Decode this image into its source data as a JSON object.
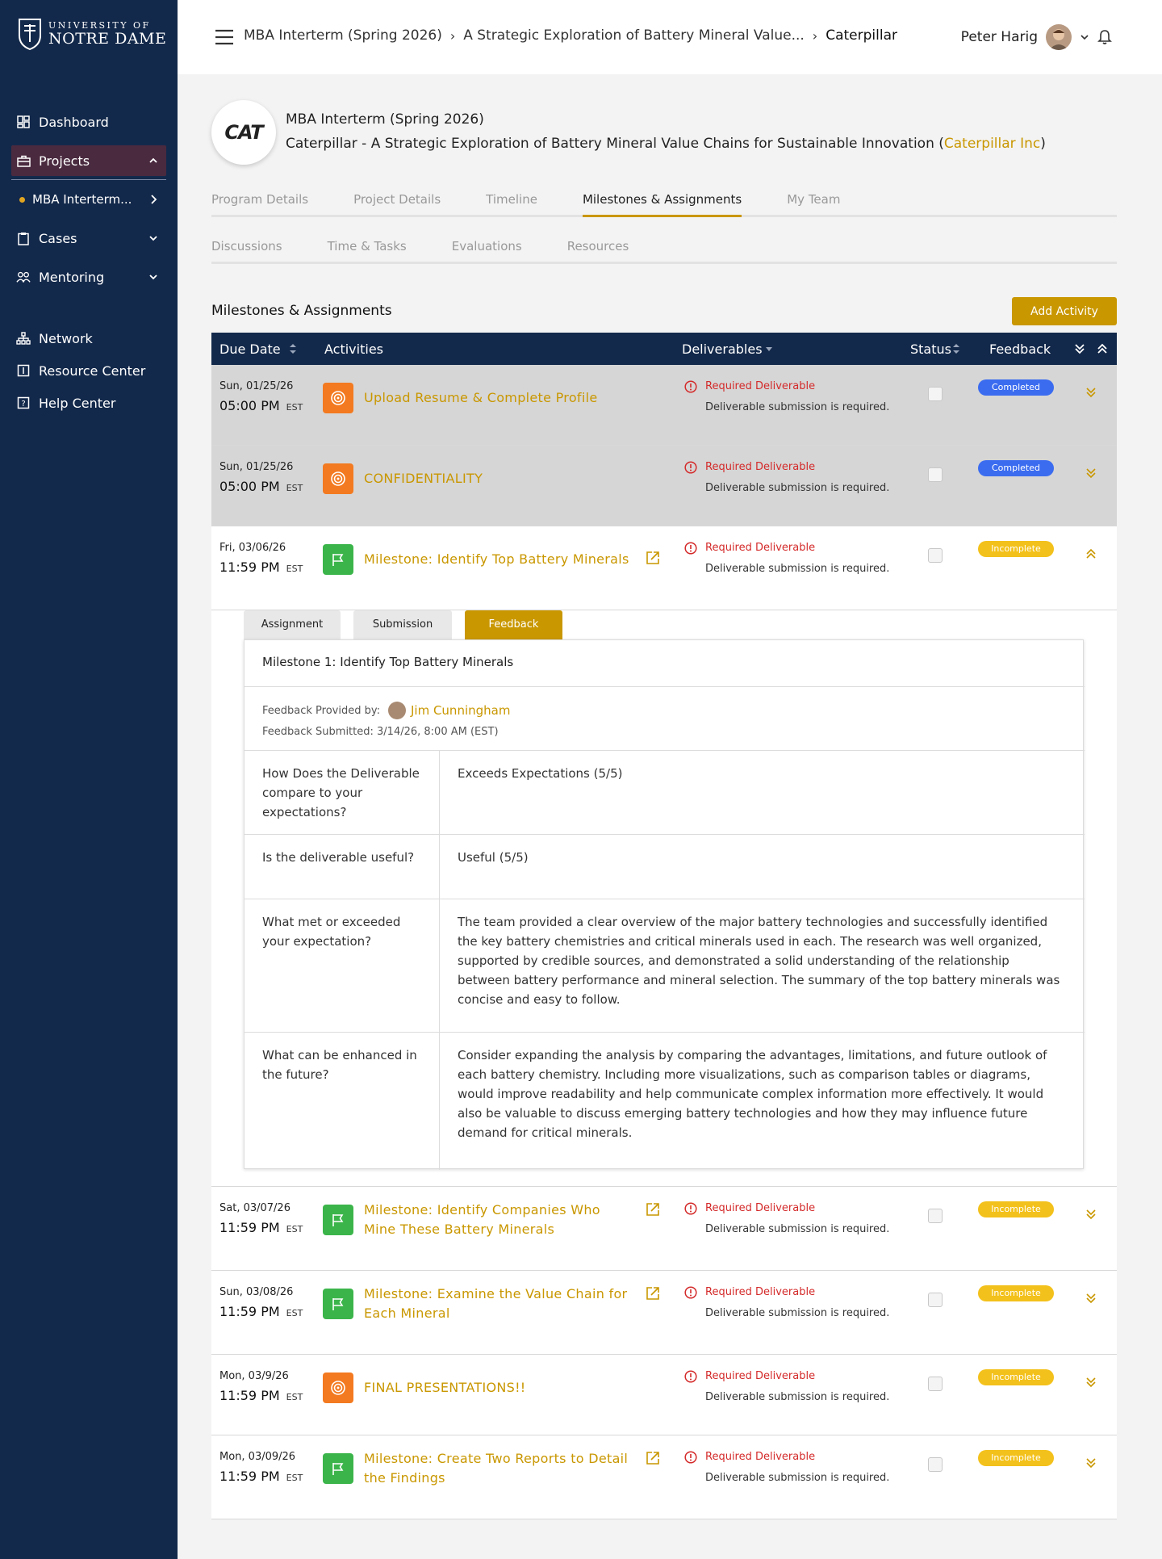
{
  "sidebar": {
    "logo": {
      "line1": "UNIVERSITY OF",
      "line2": "NOTRE DAME"
    },
    "items": [
      {
        "label": "Dashboard",
        "icon": "dashboard-icon"
      },
      {
        "label": "Projects",
        "icon": "briefcase-icon"
      },
      {
        "label": "MBA Interterm...",
        "icon": "dot"
      },
      {
        "label": "Cases",
        "icon": "clipboard-icon"
      },
      {
        "label": "Mentoring",
        "icon": "people-icon"
      },
      {
        "label": "Network",
        "icon": "network-icon"
      },
      {
        "label": "Resource Center",
        "icon": "book-icon"
      },
      {
        "label": "Help Center",
        "icon": "help-icon"
      }
    ]
  },
  "topbar": {
    "crumbs": [
      "MBA Interterm (Spring 2026)",
      "A Strategic Exploration of Battery Mineral Value...",
      "Caterpillar"
    ],
    "user_name": "Peter Harig"
  },
  "header": {
    "logo_text": "CAT",
    "program": "MBA Interterm (Spring 2026)",
    "project_prefix": "Caterpillar - A Strategic Exploration of Battery Mineral Value Chains for Sustainable Innovation (",
    "company": "Caterpillar Inc",
    "project_suffix": ")"
  },
  "tabs1": [
    "Program Details",
    "Project Details",
    "Timeline",
    "Milestones & Assignments",
    "My Team"
  ],
  "tabs2": [
    "Discussions",
    "Time & Tasks",
    "Evaluations",
    "Resources"
  ],
  "section_title": "Milestones & Assignments",
  "add_activity": "Add Activity",
  "table_headers": {
    "due": "Due Date",
    "activities": "Activities",
    "deliverables": "Deliverables",
    "status": "Status",
    "feedback": "Feedback"
  },
  "rows": [
    {
      "date": "Sun, 01/25/26",
      "time": "05:00 PM",
      "tz": "EST",
      "title": "Upload Resume & Complete Profile",
      "icon": "target-icon",
      "req": "Required Deliverable",
      "sub": "Deliverable submission is required.",
      "badge": "Completed"
    },
    {
      "date": "Sun, 01/25/26",
      "time": "05:00 PM",
      "tz": "EST",
      "title": "CONFIDENTIALITY",
      "icon": "target-icon",
      "req": "Required Deliverable",
      "sub": "Deliverable submission is required.",
      "badge": "Completed"
    },
    {
      "date": "Fri, 03/06/26",
      "time": "11:59 PM",
      "tz": "EST",
      "title": "Milestone: Identify Top Battery Minerals",
      "icon": "flag-icon",
      "req": "Required Deliverable",
      "sub": "Deliverable submission is required.",
      "badge": "Incomplete"
    },
    {
      "date": "Sat, 03/07/26",
      "time": "11:59 PM",
      "tz": "EST",
      "title": "Milestone: Identify Companies Who Mine These Battery Minerals",
      "icon": "flag-icon",
      "req": "Required Deliverable",
      "sub": "Deliverable submission is required.",
      "badge": "Incomplete"
    },
    {
      "date": "Sun, 03/08/26",
      "time": "11:59 PM",
      "tz": "EST",
      "title": "Milestone: Examine the Value Chain for Each Mineral",
      "icon": "flag-icon",
      "req": "Required Deliverable",
      "sub": "Deliverable submission is required.",
      "badge": "Incomplete"
    },
    {
      "date": "Mon, 03/9/26",
      "time": "11:59 PM",
      "tz": "EST",
      "title": "FINAL PRESENTATIONS!!",
      "icon": "target-icon",
      "req": "Required Deliverable",
      "sub": "Deliverable submission is required.",
      "badge": "Incomplete"
    },
    {
      "date": "Mon, 03/09/26",
      "time": "11:59 PM",
      "tz": "EST",
      "title": "Milestone: Create Two Reports to Detail the Findings",
      "icon": "flag-icon",
      "req": "Required Deliverable",
      "sub": "Deliverable submission is required.",
      "badge": "Incomplete"
    }
  ],
  "panel": {
    "tabs": [
      "Assignment",
      "Submission",
      "Feedback"
    ],
    "title": "Milestone 1: Identify Top Battery Minerals",
    "provided_by_label": "Feedback Provided by:",
    "provider": "Jim Cunningham",
    "submitted": "Feedback Submitted: 3/14/26, 8:00 AM (EST)",
    "qa": [
      {
        "q": "How Does the Deliverable compare to your expectations?",
        "a": "Exceeds Expectations (5/5)"
      },
      {
        "q": "Is the deliverable useful?",
        "a": "Useful (5/5)"
      },
      {
        "q": "What met or exceeded your expectation?",
        "a": "The team provided a clear overview of the major battery technologies and successfully identified the key battery chemistries and critical minerals used in each. The research was well organized, supported by credible sources, and demonstrated a solid understanding of the relationship between battery performance and mineral selection. The summary of the top battery minerals was concise and easy to follow."
      },
      {
        "q": "What can be enhanced in the future?",
        "a": "Consider expanding the analysis by comparing the advantages, limitations, and future outlook of each battery chemistry. Including more visualizations, such as comparison tables or diagrams, would improve readability and help communicate complex information more effectively. It would also be valuable to discuss emerging battery technologies and how they may influence future demand for critical minerals."
      }
    ]
  },
  "colors": {
    "navy": "#13294b",
    "gold": "#c99700",
    "orange": "#f37a20",
    "green": "#3bb54a",
    "red": "#d42a2a",
    "blue": "#3b6cf0",
    "yellow": "#f3c11b"
  }
}
